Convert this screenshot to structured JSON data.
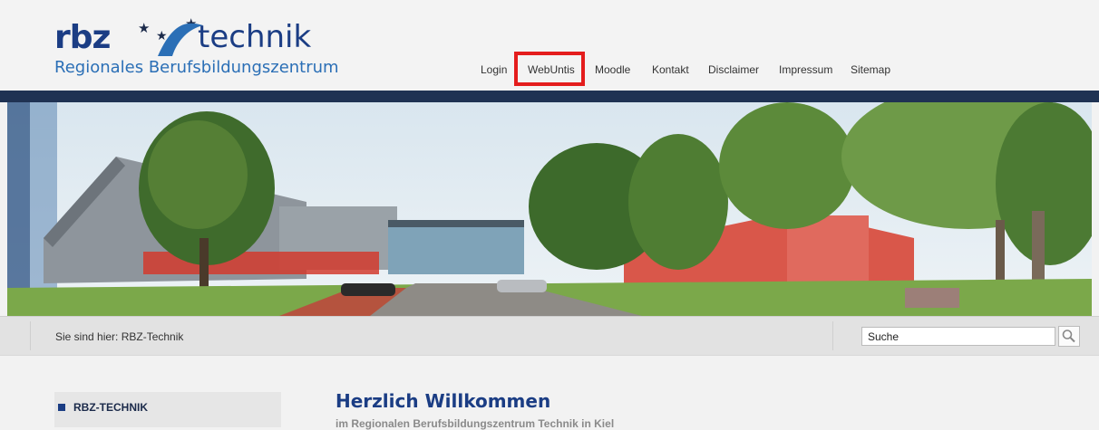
{
  "logo": {
    "brand_rbz": "rbz",
    "brand_technik": "technik",
    "subtitle": "Regionales Berufsbildungszentrum",
    "star_color": "#1b2a4a",
    "swoosh_color": "#2b6fb6"
  },
  "nav": {
    "items": [
      "Login",
      "WebUntis",
      "Moodle",
      "Kontakt",
      "Disclaimer",
      "Impressum",
      "Sitemap"
    ],
    "highlighted": "WebUntis",
    "highlight_color": "#e41d1d"
  },
  "banner": {
    "band_color": "#1f3253"
  },
  "breadcrumb": {
    "text": "Sie sind hier: RBZ-Technik"
  },
  "search": {
    "value": "Suche",
    "icon": "search-icon"
  },
  "sidebar": {
    "items": [
      {
        "label": "RBZ-TECHNIK"
      }
    ]
  },
  "main": {
    "title": "Herzlich Willkommen",
    "subtitle": "im Regionalen Berufsbildungszentrum Technik in Kiel"
  },
  "colors": {
    "brand_blue": "#1b3d84",
    "accent_blue": "#2b6fb6",
    "background": "#f2f2f2"
  }
}
